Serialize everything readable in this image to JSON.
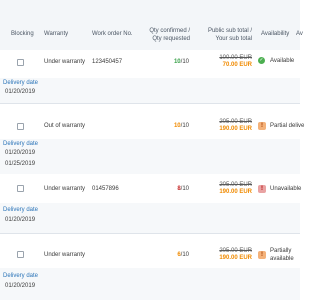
{
  "columns": {
    "blocking": "Blocking",
    "warranty": "Warranty",
    "work_order": "Work order No.",
    "qty_line1": "Qty confirmed /",
    "qty_line2": "Qty requested",
    "price_line1": "Public sub total /",
    "price_line2": "Your sub total",
    "availability": "Availability",
    "extra": "Av"
  },
  "delivery_label": "Delivery date",
  "rows": [
    {
      "warranty": "Under warranty",
      "work_order": "123450457",
      "qty_confirmed": "10",
      "qty_requested": "/10",
      "qty_color": "#3aa14a",
      "price_old": "100.00 EUR",
      "price_new": "70.00 EUR",
      "availability": "Available",
      "availability_icon": "check-circle-icon",
      "dates": [
        "01/20/2019"
      ]
    },
    {
      "warranty": "Out of warranty",
      "work_order": "",
      "qty_confirmed": "10",
      "qty_requested": "/10",
      "qty_color": "#f08a00",
      "price_old": "205.00 EUR",
      "price_new": "190.00 EUR",
      "availability": "Partial delive",
      "availability_icon": "warning-triangle-icon",
      "dates": [
        "01/20/2019",
        "01/25/2019"
      ]
    },
    {
      "warranty": "Under warranty",
      "work_order": "01457896",
      "qty_confirmed": "8",
      "qty_requested": "/10",
      "qty_color": "#c62828",
      "price_old": "205.00 EUR",
      "price_new": "190.00 EUR",
      "availability": "Unavailable",
      "availability_icon": "error-triangle-icon",
      "dates": [
        "01/20/2019"
      ]
    },
    {
      "warranty": "Under warranty",
      "work_order": "",
      "qty_confirmed": "6",
      "qty_requested": "/10",
      "qty_color": "#f08a00",
      "price_old": "205.00 EUR",
      "price_new": "190.00 EUR",
      "availability_line1": "Partially",
      "availability_line2": "available",
      "availability_icon": "warning-triangle-icon",
      "dates": [
        "01/20/2019"
      ]
    }
  ]
}
